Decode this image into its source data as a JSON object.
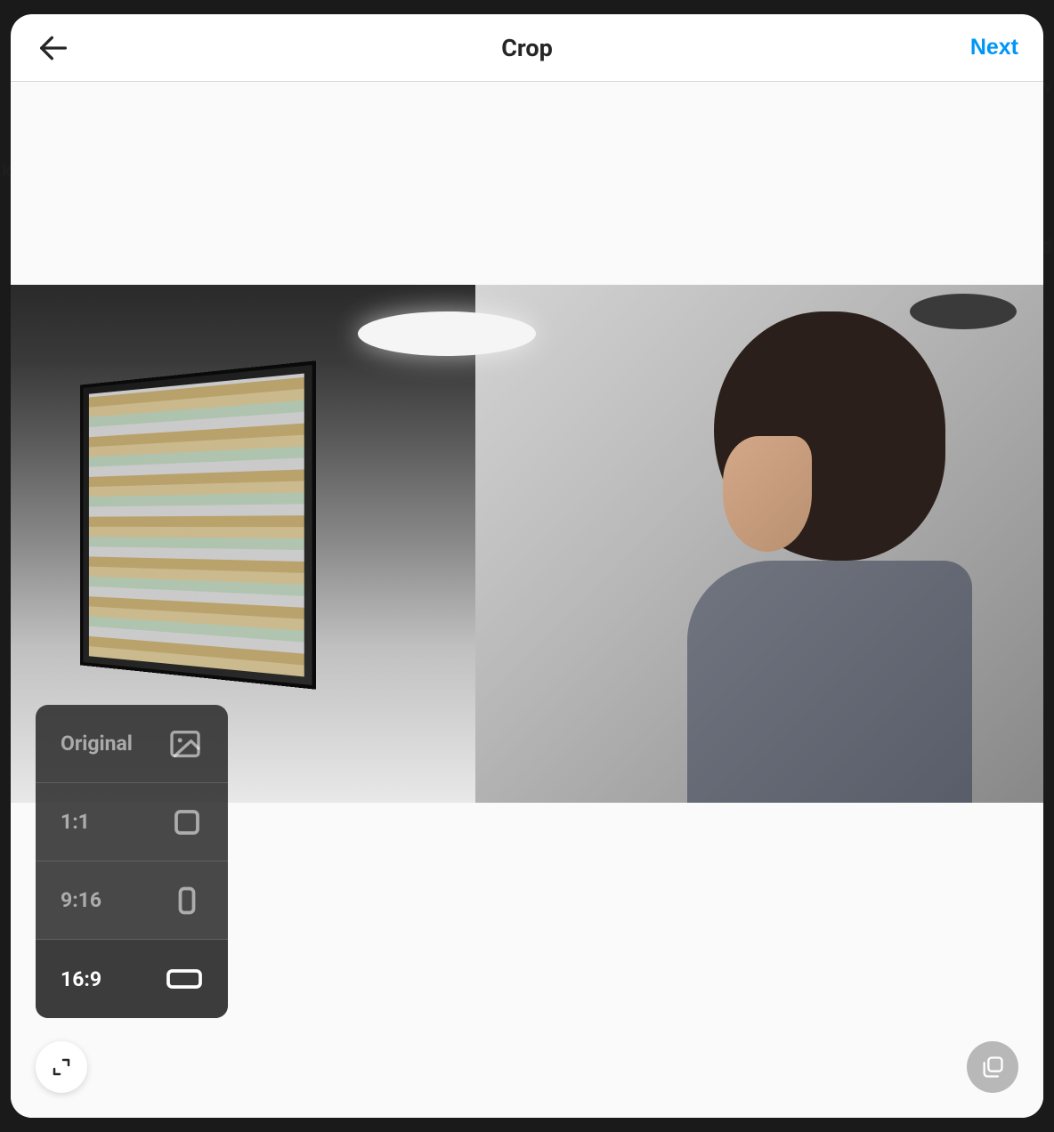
{
  "header": {
    "title": "Crop",
    "next_label": "Next"
  },
  "aspect_ratios": {
    "original": "Original",
    "square": "1:1",
    "portrait": "9:16",
    "landscape": "16:9"
  },
  "selected_ratio": "16:9",
  "icons": {
    "back": "arrow-left-icon",
    "image": "image-icon",
    "square": "square-icon",
    "portrait_rect": "portrait-rect-icon",
    "landscape_rect": "landscape-rect-icon",
    "expand": "expand-icon",
    "multi": "multi-select-icon"
  }
}
